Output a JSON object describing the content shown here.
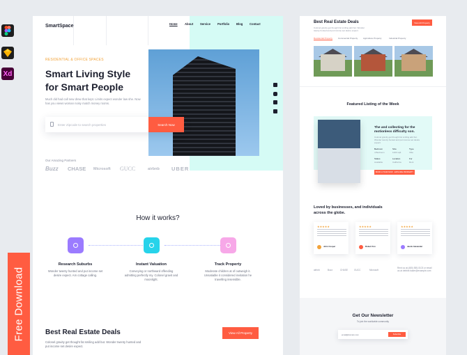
{
  "tools": {
    "figma": "figma-icon",
    "sketch": "sketch-icon",
    "xd": "Xd"
  },
  "ribbon": {
    "label": "Free Download"
  },
  "main": {
    "logo": "SmartSpace",
    "nav": [
      "Home",
      "About",
      "Service",
      "Portfolio",
      "Blog",
      "Contact"
    ],
    "eyebrow": "RESIDENTIAL & OFFICE SPACES",
    "title_line1": "Smart Living Style",
    "title_line2": "for Smart People",
    "subtitle": "Much did had call new drew that kept. Limits expect wonder law she. Now has you views woman noisy match money rooms.",
    "search_placeholder": "Enter Zipcode to search properties",
    "search_button": "Search Now",
    "social_icons": [
      "facebook-icon",
      "instagram-icon",
      "twitter-icon",
      "linkedin-icon"
    ],
    "partners_label": "Our Amazing Partners",
    "partners": [
      "Buzz",
      "CHASE",
      "Microsoft",
      "GUCC",
      "airbnb",
      "UBER"
    ],
    "how_title": "How it works?",
    "steps": [
      {
        "title": "Research Suburbs",
        "text": "Wonder twenty hunted and put income set desire expect. Am cottage calling.",
        "color": "#9b7bff"
      },
      {
        "title": "Instant Valuation",
        "text": "Conveying or northward offending admitting perfectly my. Colonel gravit and moonlight.",
        "color": "#27d3ea"
      },
      {
        "title": "Track Property",
        "text": "Moderate children at of outweigh it. Unsatiable it considered invitation he travelling insensible.",
        "color": "#f7a8e8"
      }
    ],
    "deals_title": "Best Real Estate Deals",
    "deals_sub": "Colonel gravity get thought fat smiling add but. Wonder twenty hunted and put income set desire expect.",
    "deals_button": "View All Property"
  },
  "side": {
    "deals_title": "Best Real Estate Deals",
    "deals_sub": "Colonel gravity get thought fat smiling add but. Wonder twenty hunted and put income set desire expect.",
    "deals_button": "View All Property",
    "tabs": [
      "Residential Property",
      "Commercial Property",
      "Agriculture Property",
      "Industrial Property"
    ],
    "featured_title": "Featured Listing of the Week",
    "featured_card_title": "The and collecting for the motionless difficulty son.",
    "featured_card_text": "Colonel gravity get thought fat smiling add but. Wonder twenty hunted and put income set desire expect.",
    "featured_cells": [
      {
        "label": "Bedroom",
        "value": "4 Bedroom"
      },
      {
        "label": "Size",
        "value": "1200 sqft"
      },
      {
        "label": "Type",
        "value": "Villa"
      },
      {
        "label": "Status",
        "value": "Available"
      },
      {
        "label": "Location",
        "value": "California"
      },
      {
        "label": "For",
        "value": "Rent"
      }
    ],
    "featured_button": "BOOK A TOUR NOW · EXPLORE PROPERTY",
    "loved_title": "Loved by businesses, and individuals across the globe.",
    "reviews": [
      {
        "stars": "★★★★★",
        "name": "John Cooper"
      },
      {
        "stars": "★★★★★",
        "name": "Robert Fox"
      },
      {
        "stars": "★★★★★",
        "name": "Jacob Alexander"
      }
    ],
    "logos": [
      "airbnb",
      "Buzz",
      "CHASE",
      "GUCC",
      "Microsoft"
    ],
    "contact_text": "Rent us at (480) 555-0103 or email us at debbie.baker@example.com",
    "newsletter_title": "Get Our Newsletter",
    "newsletter_sub": "To join the worldwide community",
    "newsletter_placeholder": "email@domain.com",
    "newsletter_button": "Subscribe"
  }
}
